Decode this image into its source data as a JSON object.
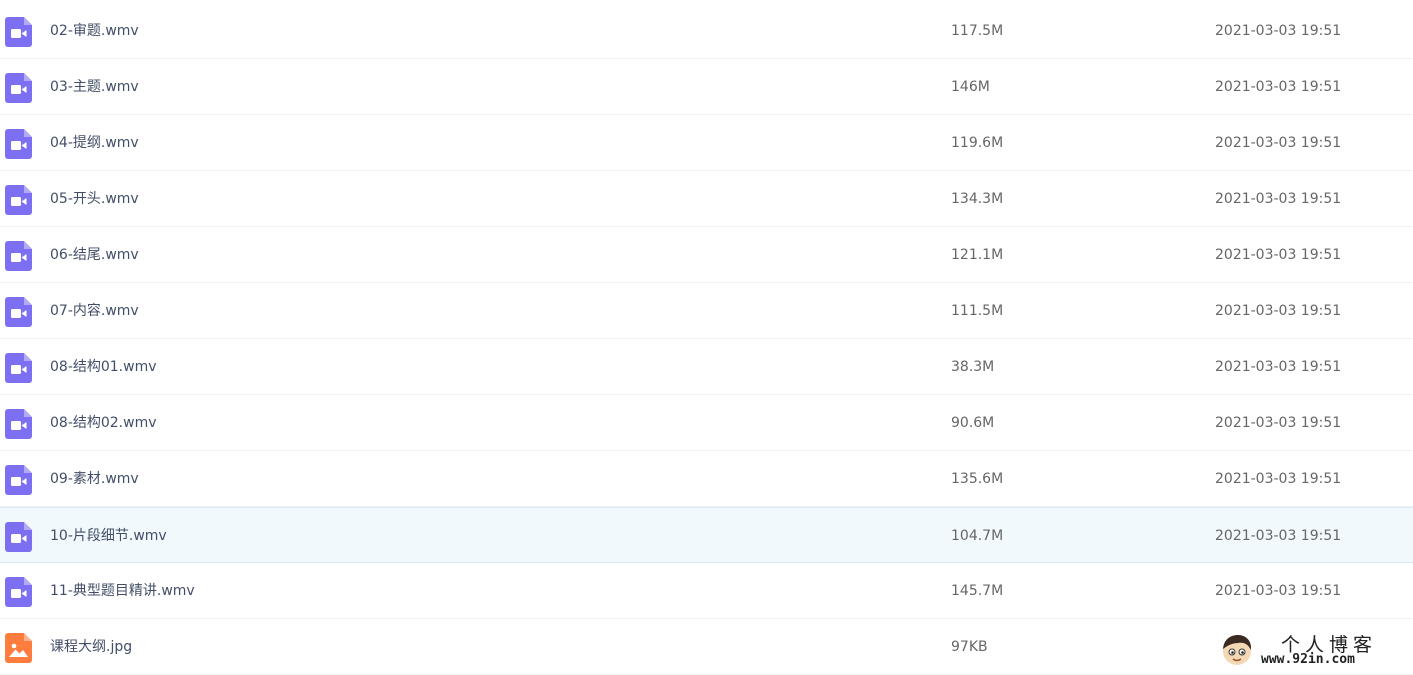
{
  "file_list": {
    "colors": {
      "video_icon": "#7d6ff2",
      "image_icon": "#ff7c3f",
      "selected_row_bg": "#f2f9fd"
    },
    "rows": [
      {
        "name": "02-审题.wmv",
        "size": "117.5M",
        "date": "2021-03-03 19:51",
        "icon": "video-file-icon"
      },
      {
        "name": "03-主题.wmv",
        "size": "146M",
        "date": "2021-03-03 19:51",
        "icon": "video-file-icon"
      },
      {
        "name": "04-提纲.wmv",
        "size": "119.6M",
        "date": "2021-03-03 19:51",
        "icon": "video-file-icon"
      },
      {
        "name": "05-开头.wmv",
        "size": "134.3M",
        "date": "2021-03-03 19:51",
        "icon": "video-file-icon"
      },
      {
        "name": "06-结尾.wmv",
        "size": "121.1M",
        "date": "2021-03-03 19:51",
        "icon": "video-file-icon"
      },
      {
        "name": "07-内容.wmv",
        "size": "111.5M",
        "date": "2021-03-03 19:51",
        "icon": "video-file-icon"
      },
      {
        "name": "08-结构01.wmv",
        "size": "38.3M",
        "date": "2021-03-03 19:51",
        "icon": "video-file-icon"
      },
      {
        "name": "08-结构02.wmv",
        "size": "90.6M",
        "date": "2021-03-03 19:51",
        "icon": "video-file-icon"
      },
      {
        "name": "09-素材.wmv",
        "size": "135.6M",
        "date": "2021-03-03 19:51",
        "icon": "video-file-icon"
      },
      {
        "name": "10-片段细节.wmv",
        "size": "104.7M",
        "date": "2021-03-03 19:51",
        "icon": "video-file-icon",
        "selected": true
      },
      {
        "name": "11-典型题目精讲.wmv",
        "size": "145.7M",
        "date": "2021-03-03 19:51",
        "icon": "video-file-icon"
      },
      {
        "name": "课程大纲.jpg",
        "size": "97KB",
        "date": "",
        "icon": "image-file-icon"
      }
    ]
  },
  "watermark": {
    "title": "个人博客",
    "url": "www.92in.com"
  }
}
